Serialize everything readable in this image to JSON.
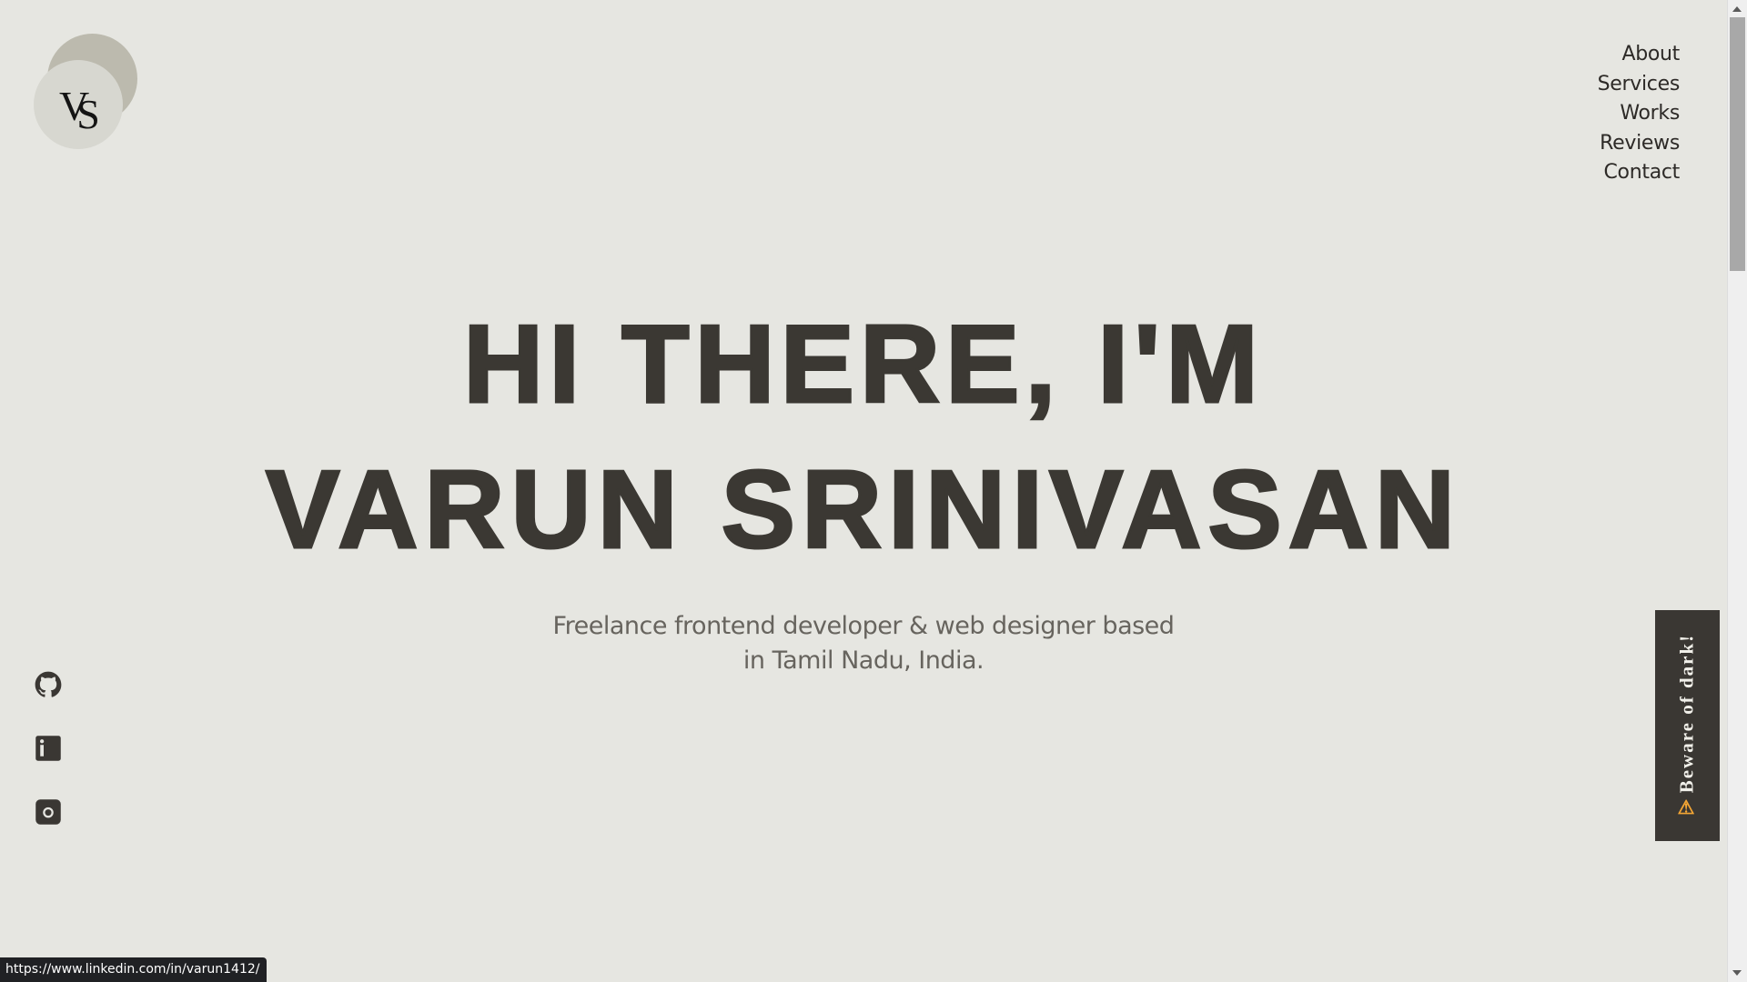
{
  "logo": {
    "monogram_v": "V",
    "monogram_s": "S"
  },
  "nav": {
    "items": [
      {
        "label": "About"
      },
      {
        "label": "Services"
      },
      {
        "label": "Works"
      },
      {
        "label": "Reviews"
      },
      {
        "label": "Contact"
      }
    ]
  },
  "hero": {
    "line1": "HI THERE, I'M",
    "line2": "VARUN SRINIVASAN",
    "tagline_line1": "Freelance frontend developer & web designer based",
    "tagline_line2": "in Tamil Nadu, India."
  },
  "social": {
    "icons": [
      "github-icon",
      "linkedin-icon",
      "instagram-icon"
    ]
  },
  "dark_toggle": {
    "icon": "warning-icon",
    "warn_glyph": "⚠",
    "label": "Beware of dark!"
  },
  "status_bar": {
    "url": "https://www.linkedin.com/in/varun1412/"
  },
  "colors": {
    "background": "#e6e6e1",
    "text_dark": "#3b3833",
    "accent_warning": "#f3a534"
  }
}
